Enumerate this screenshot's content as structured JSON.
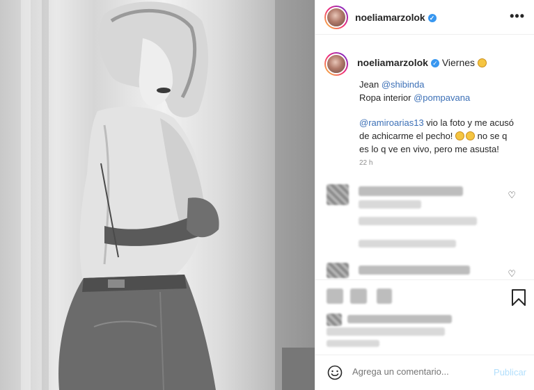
{
  "post": {
    "username": "noeliamarzolok",
    "more_label": "•••",
    "verified": true
  },
  "caption": {
    "username": "noeliamarzolok",
    "first_line": "Viernes",
    "jean_label": "Jean",
    "jean_mention": "@shibinda",
    "lingerie_label": "Ropa interior",
    "lingerie_mention": "@pompavana",
    "mention2": "@ramiroarias13",
    "line3": "vio la foto y me acusó",
    "line4": "de achicarme el pecho!",
    "line4b": "no se q",
    "line5": "es lo q ve en vivo, pero me asusta!",
    "time": "22 h"
  },
  "comment_bar": {
    "placeholder": "Agrega un comentario...",
    "publish_label": "Publicar"
  },
  "icons": {
    "verified": "check-badge-icon",
    "heart": "heart-icon",
    "bookmark": "bookmark-icon",
    "emoji": "smile-icon"
  },
  "colors": {
    "mention": "#3b6fb6",
    "verified": "#3897f0",
    "publish": "#b2dffc"
  }
}
